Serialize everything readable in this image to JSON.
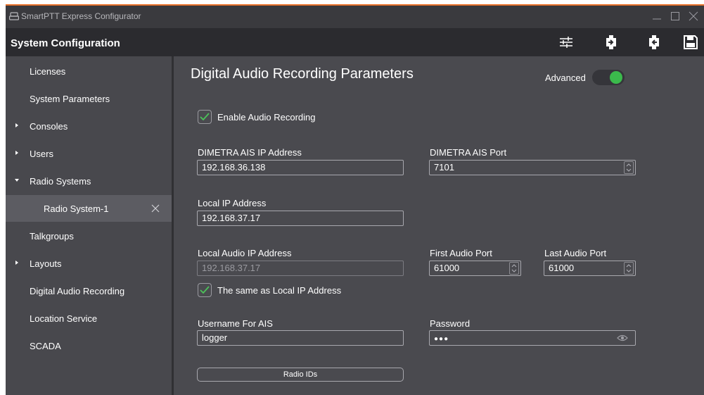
{
  "app": {
    "title": "SmartPTT Express Configurator"
  },
  "header": {
    "title": "System Configuration"
  },
  "toolbar": {
    "icons": [
      "filter-settings-icon",
      "import-icon",
      "export-icon",
      "save-icon"
    ]
  },
  "sidebar": {
    "items": [
      {
        "label": "Licenses",
        "arrow": ""
      },
      {
        "label": "System Parameters",
        "arrow": ""
      },
      {
        "label": "Consoles",
        "arrow": "collapsed"
      },
      {
        "label": "Users",
        "arrow": "collapsed"
      },
      {
        "label": "Radio Systems",
        "arrow": "expanded"
      },
      {
        "label": "Radio System-1",
        "arrow": "",
        "selected": true
      },
      {
        "label": "Talkgroups",
        "arrow": ""
      },
      {
        "label": "Layouts",
        "arrow": "collapsed"
      },
      {
        "label": "Digital Audio Recording",
        "arrow": ""
      },
      {
        "label": "Location Service",
        "arrow": ""
      },
      {
        "label": "SCADA",
        "arrow": ""
      }
    ]
  },
  "main": {
    "title": "Digital Audio Recording Parameters",
    "advanced_label": "Advanced",
    "advanced_on": true,
    "enable_recording": {
      "label": "Enable Audio Recording",
      "checked": true
    },
    "ais_ip": {
      "label": "DIMETRA AIS IP Address",
      "value": "192.168.36.138"
    },
    "ais_port": {
      "label": "DIMETRA AIS Port",
      "value": "7101"
    },
    "local_ip": {
      "label": "Local IP Address",
      "value": "192.168.37.17"
    },
    "local_audio_ip": {
      "label": "Local Audio IP Address",
      "value": "192.168.37.17"
    },
    "first_port": {
      "label": "First Audio Port",
      "value": "61000"
    },
    "last_port": {
      "label": "Last Audio Port",
      "value": "61000"
    },
    "same_as_local": {
      "label": "The same as Local IP Address",
      "checked": true
    },
    "username": {
      "label": "Username For AIS",
      "value": "logger"
    },
    "password": {
      "label": "Password",
      "value": "●●●"
    },
    "radio_ids_button": "Radio IDs"
  },
  "colors": {
    "accent": "#e8722a",
    "toggle_on": "#3bba4c",
    "check": "#4cc35a"
  }
}
